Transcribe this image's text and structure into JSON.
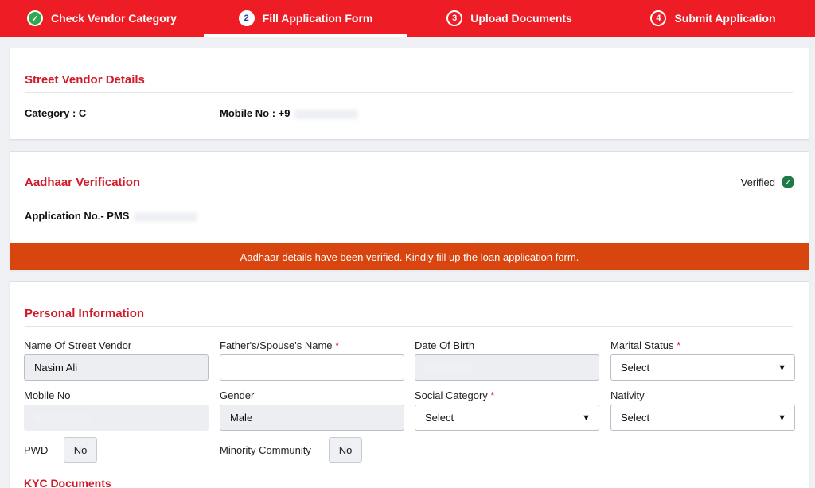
{
  "stepper": {
    "steps": [
      {
        "num": "✓",
        "label": "Check Vendor Category"
      },
      {
        "num": "2",
        "label": "Fill Application Form"
      },
      {
        "num": "3",
        "label": "Upload Documents"
      },
      {
        "num": "4",
        "label": "Submit Application"
      }
    ]
  },
  "vendor": {
    "title": "Street Vendor Details",
    "category": "Category : C",
    "mobile": "Mobile No : +9"
  },
  "aadhaar": {
    "title": "Aadhaar Verification",
    "verified": "Verified",
    "app_no": "Application No.- PMS",
    "banner": "Aadhaar details have been verified. Kindly fill up the loan application form."
  },
  "personal": {
    "title": "Personal Information",
    "name_label": "Name Of Street Vendor",
    "name_value": "Nasim Ali",
    "father_label": "Father's/Spouse's Name",
    "dob_label": "Date Of Birth",
    "marital_label": "Marital Status",
    "marital_value": "Select",
    "mobile_label": "Mobile No",
    "gender_label": "Gender",
    "gender_value": "Male",
    "social_label": "Social Category",
    "social_value": "Select",
    "nativity_label": "Nativity",
    "nativity_value": "Select",
    "pwd_label": "PWD",
    "pwd_value": "No",
    "minority_label": "Minority Community",
    "minority_value": "No",
    "required_mark": "*"
  },
  "kyc": {
    "title": "KYC Documents"
  }
}
